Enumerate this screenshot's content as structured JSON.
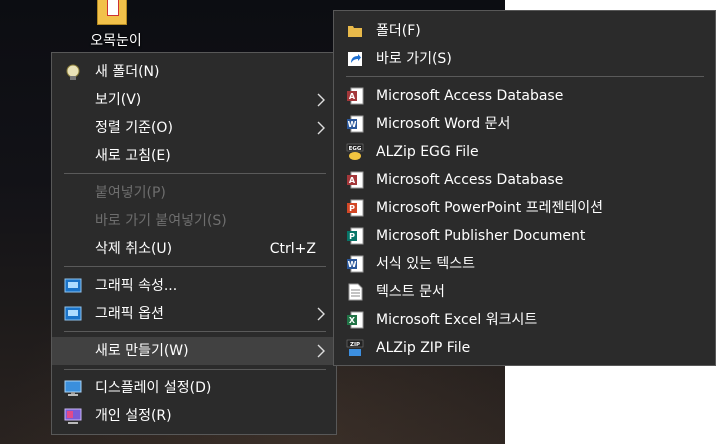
{
  "desktop": {
    "icon_label": "오목눈이"
  },
  "main_menu": {
    "items": [
      {
        "label": "새 폴더(N)"
      },
      {
        "label": "보기(V)"
      },
      {
        "label": "정렬 기준(O)"
      },
      {
        "label": "새로 고침(E)"
      },
      {
        "label": "붙여넣기(P)"
      },
      {
        "label": "바로 가기 붙여넣기(S)"
      },
      {
        "label": "삭제 취소(U)",
        "shortcut": "Ctrl+Z"
      },
      {
        "label": "그래픽 속성..."
      },
      {
        "label": "그래픽 옵션"
      },
      {
        "label": "새로 만들기(W)"
      },
      {
        "label": "디스플레이 설정(D)"
      },
      {
        "label": "개인 설정(R)"
      }
    ]
  },
  "sub_menu": {
    "items": [
      {
        "label": "폴더(F)"
      },
      {
        "label": "바로 가기(S)"
      },
      {
        "label": "Microsoft Access Database"
      },
      {
        "label": "Microsoft Word 문서"
      },
      {
        "label": "ALZip EGG File"
      },
      {
        "label": "Microsoft Access Database"
      },
      {
        "label": "Microsoft PowerPoint 프레젠테이션"
      },
      {
        "label": "Microsoft Publisher Document"
      },
      {
        "label": "서식 있는 텍스트"
      },
      {
        "label": "텍스트 문서"
      },
      {
        "label": "Microsoft Excel 워크시트"
      },
      {
        "label": "ALZip ZIP File"
      }
    ]
  },
  "colors": {
    "menu_bg": "#2b2b2b",
    "menu_highlight": "#414141",
    "disabled_text": "#6e6e6e",
    "access_red": "#a4373a",
    "word_blue": "#2b579a",
    "powerpoint_orange": "#d24726",
    "publisher_teal": "#077568",
    "excel_green": "#217346"
  }
}
